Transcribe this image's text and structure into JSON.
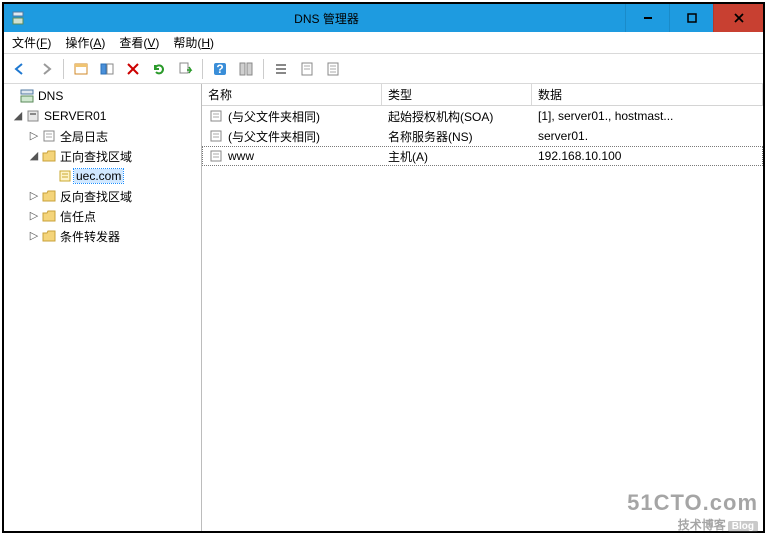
{
  "window": {
    "title": "DNS 管理器"
  },
  "menu": {
    "file": "文件(F)",
    "action": "操作(A)",
    "view": "查看(V)",
    "help": "帮助(H)"
  },
  "tree": {
    "root": "DNS",
    "server": "SERVER01",
    "global_log": "全局日志",
    "forward_zone": "正向查找区域",
    "zone_name": "uec.com",
    "reverse_zone": "反向查找区域",
    "trust_point": "信任点",
    "cond_forwarder": "条件转发器"
  },
  "columns": {
    "name": "名称",
    "type": "类型",
    "data": "数据"
  },
  "records": [
    {
      "name": "(与父文件夹相同)",
      "type": "起始授权机构(SOA)",
      "data": "[1], server01., hostmast..."
    },
    {
      "name": "(与父文件夹相同)",
      "type": "名称服务器(NS)",
      "data": "server01."
    },
    {
      "name": "www",
      "type": "主机(A)",
      "data": "192.168.10.100"
    }
  ],
  "watermark": {
    "line1": "51CTO.com",
    "line2": "技术博客",
    "badge": "Blog"
  }
}
